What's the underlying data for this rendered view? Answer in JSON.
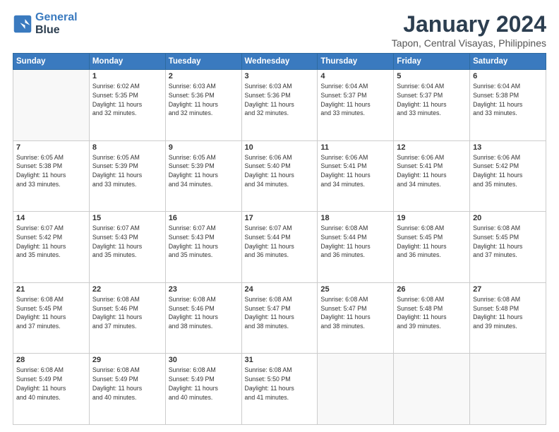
{
  "logo": {
    "line1": "General",
    "line2": "Blue"
  },
  "header": {
    "month": "January 2024",
    "location": "Tapon, Central Visayas, Philippines"
  },
  "weekdays": [
    "Sunday",
    "Monday",
    "Tuesday",
    "Wednesday",
    "Thursday",
    "Friday",
    "Saturday"
  ],
  "weeks": [
    [
      {
        "day": "",
        "info": ""
      },
      {
        "day": "1",
        "info": "Sunrise: 6:02 AM\nSunset: 5:35 PM\nDaylight: 11 hours\nand 32 minutes."
      },
      {
        "day": "2",
        "info": "Sunrise: 6:03 AM\nSunset: 5:36 PM\nDaylight: 11 hours\nand 32 minutes."
      },
      {
        "day": "3",
        "info": "Sunrise: 6:03 AM\nSunset: 5:36 PM\nDaylight: 11 hours\nand 32 minutes."
      },
      {
        "day": "4",
        "info": "Sunrise: 6:04 AM\nSunset: 5:37 PM\nDaylight: 11 hours\nand 33 minutes."
      },
      {
        "day": "5",
        "info": "Sunrise: 6:04 AM\nSunset: 5:37 PM\nDaylight: 11 hours\nand 33 minutes."
      },
      {
        "day": "6",
        "info": "Sunrise: 6:04 AM\nSunset: 5:38 PM\nDaylight: 11 hours\nand 33 minutes."
      }
    ],
    [
      {
        "day": "7",
        "info": "Sunrise: 6:05 AM\nSunset: 5:38 PM\nDaylight: 11 hours\nand 33 minutes."
      },
      {
        "day": "8",
        "info": "Sunrise: 6:05 AM\nSunset: 5:39 PM\nDaylight: 11 hours\nand 33 minutes."
      },
      {
        "day": "9",
        "info": "Sunrise: 6:05 AM\nSunset: 5:39 PM\nDaylight: 11 hours\nand 34 minutes."
      },
      {
        "day": "10",
        "info": "Sunrise: 6:06 AM\nSunset: 5:40 PM\nDaylight: 11 hours\nand 34 minutes."
      },
      {
        "day": "11",
        "info": "Sunrise: 6:06 AM\nSunset: 5:41 PM\nDaylight: 11 hours\nand 34 minutes."
      },
      {
        "day": "12",
        "info": "Sunrise: 6:06 AM\nSunset: 5:41 PM\nDaylight: 11 hours\nand 34 minutes."
      },
      {
        "day": "13",
        "info": "Sunrise: 6:06 AM\nSunset: 5:42 PM\nDaylight: 11 hours\nand 35 minutes."
      }
    ],
    [
      {
        "day": "14",
        "info": "Sunrise: 6:07 AM\nSunset: 5:42 PM\nDaylight: 11 hours\nand 35 minutes."
      },
      {
        "day": "15",
        "info": "Sunrise: 6:07 AM\nSunset: 5:43 PM\nDaylight: 11 hours\nand 35 minutes."
      },
      {
        "day": "16",
        "info": "Sunrise: 6:07 AM\nSunset: 5:43 PM\nDaylight: 11 hours\nand 35 minutes."
      },
      {
        "day": "17",
        "info": "Sunrise: 6:07 AM\nSunset: 5:44 PM\nDaylight: 11 hours\nand 36 minutes."
      },
      {
        "day": "18",
        "info": "Sunrise: 6:08 AM\nSunset: 5:44 PM\nDaylight: 11 hours\nand 36 minutes."
      },
      {
        "day": "19",
        "info": "Sunrise: 6:08 AM\nSunset: 5:45 PM\nDaylight: 11 hours\nand 36 minutes."
      },
      {
        "day": "20",
        "info": "Sunrise: 6:08 AM\nSunset: 5:45 PM\nDaylight: 11 hours\nand 37 minutes."
      }
    ],
    [
      {
        "day": "21",
        "info": "Sunrise: 6:08 AM\nSunset: 5:45 PM\nDaylight: 11 hours\nand 37 minutes."
      },
      {
        "day": "22",
        "info": "Sunrise: 6:08 AM\nSunset: 5:46 PM\nDaylight: 11 hours\nand 37 minutes."
      },
      {
        "day": "23",
        "info": "Sunrise: 6:08 AM\nSunset: 5:46 PM\nDaylight: 11 hours\nand 38 minutes."
      },
      {
        "day": "24",
        "info": "Sunrise: 6:08 AM\nSunset: 5:47 PM\nDaylight: 11 hours\nand 38 minutes."
      },
      {
        "day": "25",
        "info": "Sunrise: 6:08 AM\nSunset: 5:47 PM\nDaylight: 11 hours\nand 38 minutes."
      },
      {
        "day": "26",
        "info": "Sunrise: 6:08 AM\nSunset: 5:48 PM\nDaylight: 11 hours\nand 39 minutes."
      },
      {
        "day": "27",
        "info": "Sunrise: 6:08 AM\nSunset: 5:48 PM\nDaylight: 11 hours\nand 39 minutes."
      }
    ],
    [
      {
        "day": "28",
        "info": "Sunrise: 6:08 AM\nSunset: 5:49 PM\nDaylight: 11 hours\nand 40 minutes."
      },
      {
        "day": "29",
        "info": "Sunrise: 6:08 AM\nSunset: 5:49 PM\nDaylight: 11 hours\nand 40 minutes."
      },
      {
        "day": "30",
        "info": "Sunrise: 6:08 AM\nSunset: 5:49 PM\nDaylight: 11 hours\nand 40 minutes."
      },
      {
        "day": "31",
        "info": "Sunrise: 6:08 AM\nSunset: 5:50 PM\nDaylight: 11 hours\nand 41 minutes."
      },
      {
        "day": "",
        "info": ""
      },
      {
        "day": "",
        "info": ""
      },
      {
        "day": "",
        "info": ""
      }
    ]
  ]
}
